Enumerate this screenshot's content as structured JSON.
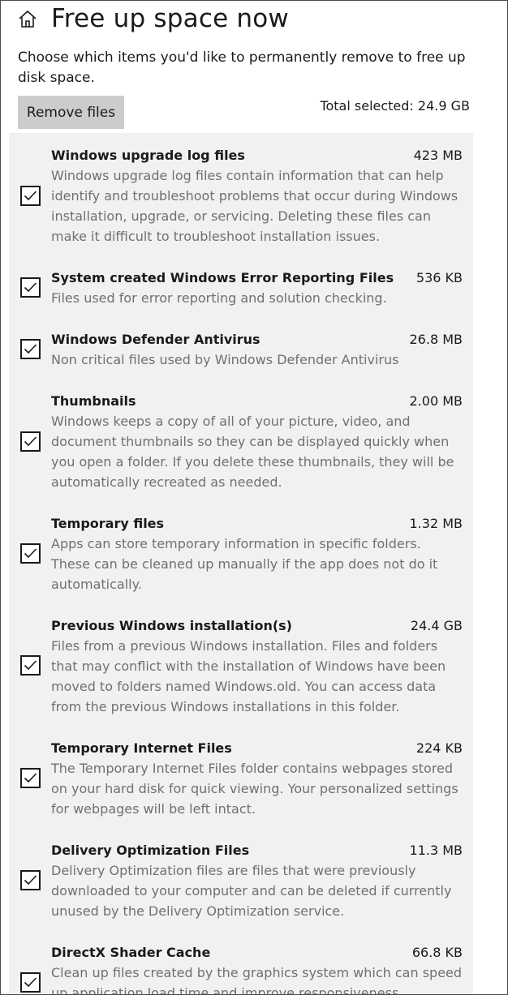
{
  "header": {
    "title": "Free up space now",
    "icon": "home-icon"
  },
  "description": "Choose which items you'd like to permanently remove to free up disk space.",
  "remove_button_label": "Remove files",
  "total_selected": "Total selected: 24.9 GB",
  "items": [
    {
      "name": "Windows upgrade log files",
      "size": "423 MB",
      "description": "Windows upgrade log files contain information that can help identify and troubleshoot problems that occur during Windows installation, upgrade, or servicing.  Deleting these files can make it difficult to troubleshoot installation issues.",
      "checked": true
    },
    {
      "name": "System created Windows Error Reporting Files",
      "size": "536 KB",
      "description": "Files used for error reporting and solution checking.",
      "checked": true
    },
    {
      "name": "Windows Defender Antivirus",
      "size": "26.8 MB",
      "description": "Non critical files used by Windows Defender Antivirus",
      "checked": true
    },
    {
      "name": "Thumbnails",
      "size": "2.00 MB",
      "description": "Windows keeps a copy of all of your picture, video, and document thumbnails so they can be displayed quickly when you open a folder. If you delete these thumbnails, they will be automatically recreated as needed.",
      "checked": true
    },
    {
      "name": "Temporary files",
      "size": "1.32 MB",
      "description": "Apps can store temporary information in specific folders. These can be cleaned up manually if the app does not do it automatically.",
      "checked": true
    },
    {
      "name": "Previous Windows installation(s)",
      "size": "24.4 GB",
      "description": "Files from a previous Windows installation.  Files and folders that may conflict with the installation of Windows have been moved to folders named Windows.old.  You can access data from the previous Windows installations in this folder.",
      "checked": true
    },
    {
      "name": "Temporary Internet Files",
      "size": "224 KB",
      "description": "The Temporary Internet Files folder contains webpages stored on your hard disk for quick viewing. Your personalized settings for webpages will be left intact.",
      "checked": true
    },
    {
      "name": "Delivery Optimization Files",
      "size": "11.3 MB",
      "description": "Delivery Optimization files are files that were previously downloaded to your computer and can be deleted if currently unused by the Delivery Optimization service.",
      "checked": true
    },
    {
      "name": "DirectX Shader Cache",
      "size": "66.8 KB",
      "description": "Clean up files created by the graphics system which can speed up application load time and improve responsiveness.",
      "checked": true
    }
  ]
}
